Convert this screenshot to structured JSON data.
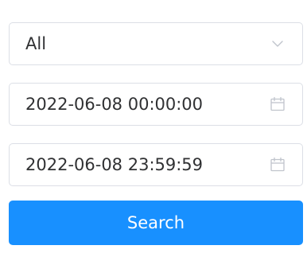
{
  "filter": {
    "type_select": {
      "value": "All",
      "icon": "chevron-down-icon"
    },
    "start_time": {
      "value": "2022-06-08 00:00:00",
      "icon": "calendar-icon"
    },
    "end_time": {
      "value": "2022-06-08 23:59:59",
      "icon": "calendar-icon"
    },
    "search_label": "Search"
  },
  "colors": {
    "primary": "#1890ff",
    "border": "#dcdfe6",
    "text": "#303133",
    "icon": "#c0c4cc"
  }
}
